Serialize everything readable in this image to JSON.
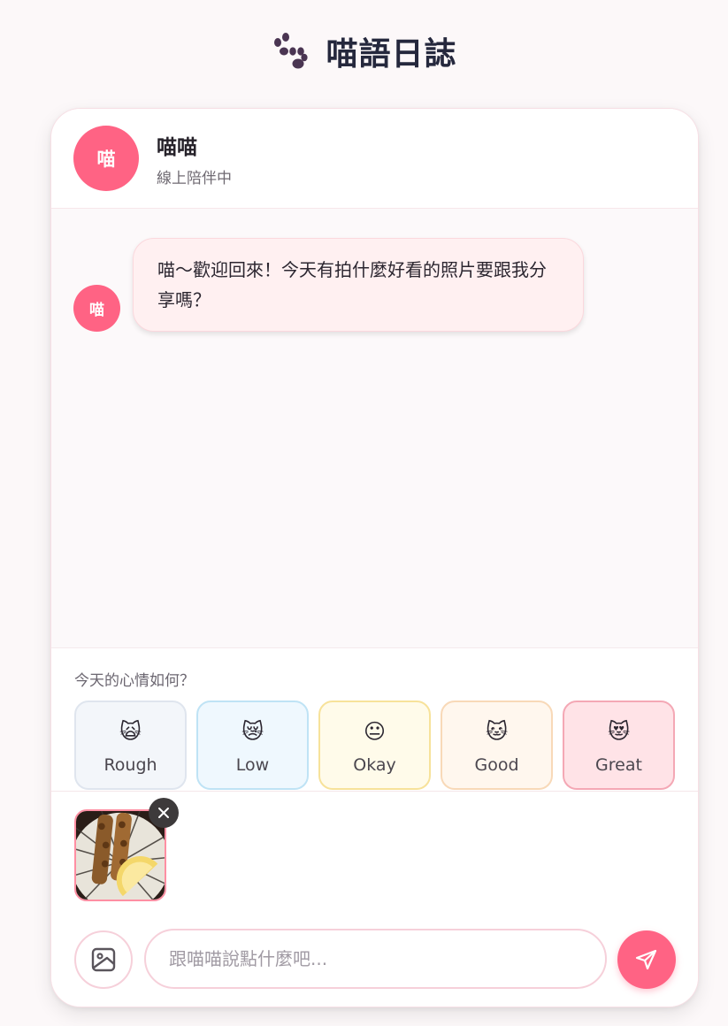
{
  "app": {
    "title": "喵語日誌",
    "icon": "paw-icon"
  },
  "chat_header": {
    "avatar_text": "喵",
    "name": "喵喵",
    "status": "線上陪伴中"
  },
  "messages": [
    {
      "sender_avatar": "喵",
      "text": "喵～歡迎回來！今天有拍什麼好看的照片要跟我分享嗎？"
    }
  ],
  "mood": {
    "question": "今天的心情如何？",
    "options": [
      {
        "label": "Rough",
        "emoji": "🙀",
        "bg": "#f3f6fa",
        "border": "#dfe5ee"
      },
      {
        "label": "Low",
        "emoji": "😿",
        "bg": "#eff8fe",
        "border": "#bfe3f5"
      },
      {
        "label": "Okay",
        "emoji": "😐",
        "bg": "#fffbea",
        "border": "#f7e29a"
      },
      {
        "label": "Good",
        "emoji": "🐱",
        "bg": "#fff7ee",
        "border": "#f8d9b8"
      },
      {
        "label": "Great",
        "emoji": "😻",
        "bg": "#ffe3e7",
        "border": "#f4a8b5"
      }
    ]
  },
  "attachment": {
    "remove_icon": "close-icon"
  },
  "composer": {
    "placeholder": "跟喵喵說點什麼吧...",
    "image_icon": "image-icon",
    "send_icon": "send-icon"
  },
  "colors": {
    "accent": "#ff6384",
    "bubble_bg": "#fff0f1",
    "title": "#25283d"
  }
}
